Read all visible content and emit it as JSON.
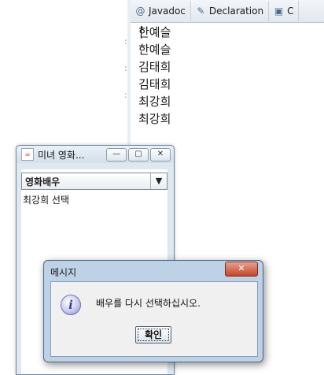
{
  "ide": {
    "tabs": [
      {
        "icon": "@",
        "label": "Javadoc"
      },
      {
        "icon": "✎",
        "label": "Declaration"
      },
      {
        "icon": "▣",
        "label": "C"
      }
    ],
    "console_lines": [
      "한예슬",
      "한예슬",
      "김태희",
      "김태희",
      "최강희",
      "최강희"
    ]
  },
  "frame": {
    "title": "미녀 영화...",
    "combo_value": "영화배우",
    "result_label": "최강희 선택"
  },
  "dialog": {
    "title": "메시지",
    "message": "배우를 다시 선택하십시오.",
    "ok_label": "확인"
  },
  "colors": {
    "dialog_frame": "#bdd2e6",
    "close_button": "#c4472b",
    "frame_border": "#6f8aa3"
  }
}
